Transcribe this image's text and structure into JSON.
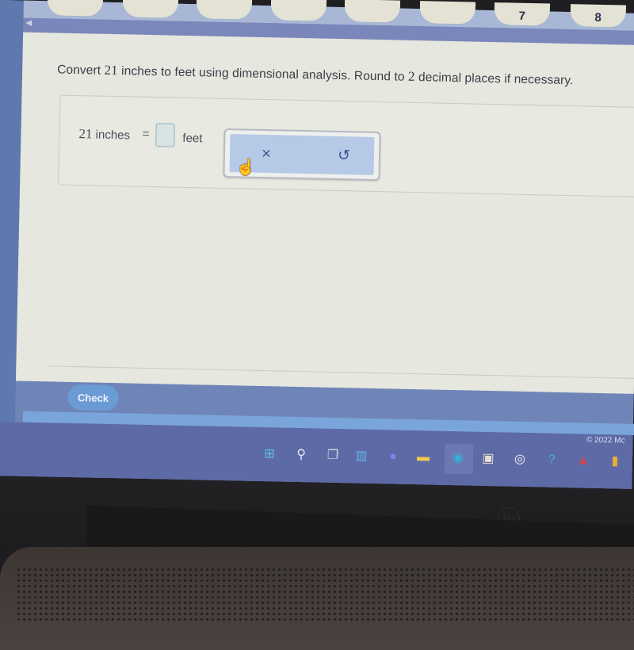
{
  "nav": {
    "tabs": [
      "",
      "",
      "",
      "",
      "",
      "",
      "7",
      "8"
    ],
    "back_icon": "chevron-left-icon"
  },
  "question": {
    "prompt_before": "Convert ",
    "prompt_number": "21",
    "prompt_after": " inches to feet using dimensional analysis. Round to ",
    "prompt_number2": "2",
    "prompt_end": " decimal places if necessary.",
    "lhs_number": "21",
    "lhs_unit": "inches",
    "equals": "=",
    "answer_value": "",
    "rhs_unit": "feet"
  },
  "tools": {
    "clear_icon": "×",
    "undo_icon": "↺",
    "cursor_icon": "☝"
  },
  "footer": {
    "check_label": "Check",
    "copyright": "© 2022 Mc"
  },
  "taskbar": {
    "icons": [
      {
        "name": "windows-start-icon",
        "glyph": "⊞",
        "color": "#5cc6e6"
      },
      {
        "name": "search-icon",
        "glyph": "⚲",
        "color": "#e8ecf5"
      },
      {
        "name": "task-view-icon",
        "glyph": "❐",
        "color": "#d4d6dc"
      },
      {
        "name": "widgets-icon",
        "glyph": "▥",
        "color": "#62b4e8"
      },
      {
        "name": "teams-chat-icon",
        "glyph": "●",
        "color": "#7b83eb"
      },
      {
        "name": "file-explorer-icon",
        "glyph": "▬",
        "color": "#f2c94c"
      },
      {
        "name": "edge-browser-icon",
        "glyph": "◉",
        "color": "#2fb3d8"
      },
      {
        "name": "store-icon",
        "glyph": "▣",
        "color": "#e6e0d0"
      },
      {
        "name": "app-circle-icon",
        "glyph": "◎",
        "color": "#f0f0f0"
      },
      {
        "name": "help-icon",
        "glyph": "?",
        "color": "#3db2e0"
      },
      {
        "name": "red-app-icon",
        "glyph": "▲",
        "color": "#d64545"
      },
      {
        "name": "multicolor-app-icon",
        "glyph": "▮",
        "color": "#e8b030"
      }
    ]
  }
}
